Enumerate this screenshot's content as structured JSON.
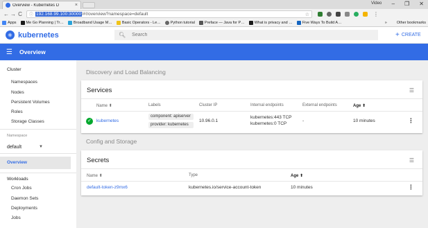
{
  "browser": {
    "tab_title": "Overview - Kubernetes D",
    "tab_close": "×",
    "profile": "Video",
    "window_controls": [
      "–",
      "❐",
      "✕"
    ],
    "url_host": "192.168.99.100:30000",
    "url_path": "/#!/overview?namespace=default",
    "bookmarks": [
      {
        "label": "Apps",
        "icon": "apps-grid-icon",
        "color": "#4285f4"
      },
      {
        "label": "Me Go Planning | Tr…",
        "icon": "bookmark-icon",
        "color": "#1a1a1a"
      },
      {
        "label": "Broadband Usage M…",
        "icon": "wave-icon",
        "color": "#29a3d9"
      },
      {
        "label": "Basic Operators - Le…",
        "icon": "python-icon",
        "color": "#f0c419"
      },
      {
        "label": "Python tutorial",
        "icon": "globe-icon",
        "color": "#666666"
      },
      {
        "label": "Preface — Java for P…",
        "icon": "document-icon",
        "color": "#555555"
      },
      {
        "label": "What is privacy and …",
        "icon": "bookmark-icon",
        "color": "#1a1a1a"
      },
      {
        "label": "Five Ways To Build A…",
        "icon": "bookmark-icon",
        "color": "#1565c0"
      }
    ],
    "bookmarks_more": "»",
    "other_bookmarks": "Other bookmarks"
  },
  "header": {
    "brand": "kubernetes",
    "search_placeholder": "Search",
    "create_label": "CREATE"
  },
  "toolbar": {
    "title": "Overview"
  },
  "sidebar": {
    "cluster_heading": "Cluster",
    "cluster_items": [
      "Namespaces",
      "Nodes",
      "Persistent Volumes",
      "Roles",
      "Storage Classes"
    ],
    "namespace_label": "Namespace",
    "namespace_value": "default",
    "overview_label": "Overview",
    "workloads_heading": "Workloads",
    "workload_items": [
      "Cron Jobs",
      "Daemon Sets",
      "Deployments",
      "Jobs"
    ]
  },
  "main": {
    "discovery_title": "Discovery and Load Balancing",
    "services": {
      "title": "Services",
      "columns": [
        "Name ⬍",
        "Labels",
        "Cluster IP",
        "Internal endpoints",
        "External endpoints",
        "Age ⬆"
      ],
      "rows": [
        {
          "name": "kubernetes",
          "labels": [
            "component: apiserver",
            "provider: kubernetes"
          ],
          "cluster_ip": "10.96.0.1",
          "internal_endpoints": [
            "kubernetes:443 TCP",
            "kubernetes:0 TCP"
          ],
          "external_endpoints": "-",
          "age": "10 minutes"
        }
      ]
    },
    "config_title": "Config and Storage",
    "secrets": {
      "title": "Secrets",
      "columns": [
        "Name ⬍",
        "Type",
        "Age ⬆"
      ],
      "rows": [
        {
          "name": "default-token-z9mx6",
          "type": "kubernetes.io/service-account-token",
          "age": "10 minutes"
        }
      ]
    }
  },
  "colors": {
    "brand_blue": "#326ce5",
    "success_green": "#00a82d"
  }
}
